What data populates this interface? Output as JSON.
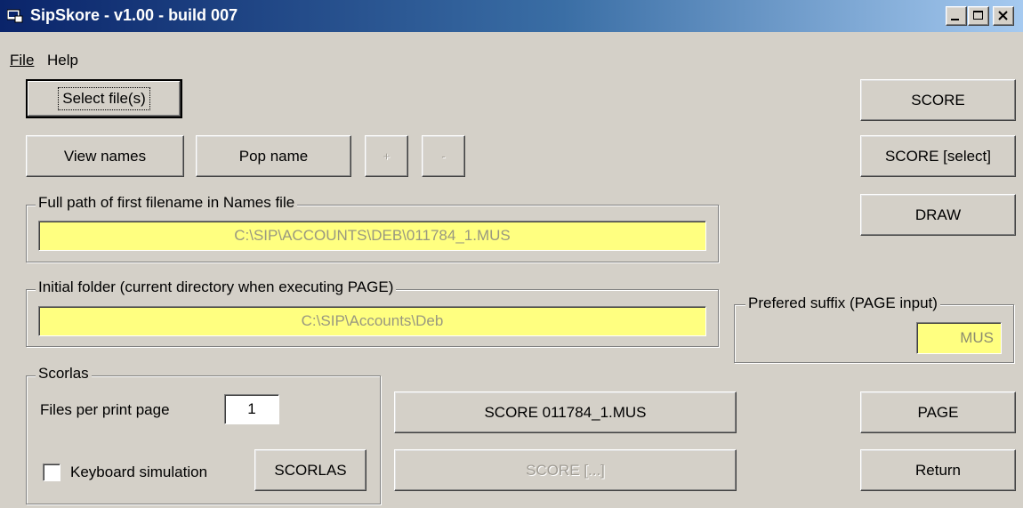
{
  "window": {
    "title": "SipSkore - v1.00 - build 007",
    "controls": [
      "minimize-icon",
      "maximize-icon",
      "close-icon"
    ]
  },
  "menu": {
    "file": "File",
    "help": "Help"
  },
  "buttons": {
    "select_files": "Select file(s)",
    "view_names": "View names",
    "pop_name": "Pop name",
    "plus": "+",
    "minus": "-",
    "score": "SCORE",
    "score_select": "SCORE [select]",
    "draw": "DRAW",
    "score_file": "SCORE 011784_1.MUS",
    "score_multi": "SCORE [...]",
    "scorlas": "SCORLAS",
    "page": "PAGE",
    "return": "Return"
  },
  "full_path": {
    "label": "Full path of first filename in Names file",
    "value": "C:\\SIP\\ACCOUNTS\\DEB\\011784_1.MUS"
  },
  "initial_folder": {
    "label": "Initial folder (current directory when executing PAGE)",
    "value": "C:\\SIP\\Accounts\\Deb"
  },
  "suffix": {
    "label": "Prefered suffix (PAGE input)",
    "value": "MUS"
  },
  "scorlas": {
    "label": "Scorlas",
    "files_per_page_label": "Files per print page",
    "files_per_page_value": "1",
    "keyboard_simulation_label": "Keyboard simulation",
    "keyboard_simulation_checked": false
  },
  "colors": {
    "field_bg": "#ffff80",
    "title_start": "#0a246a",
    "title_end": "#a6caf0",
    "face": "#d4d0c8"
  }
}
